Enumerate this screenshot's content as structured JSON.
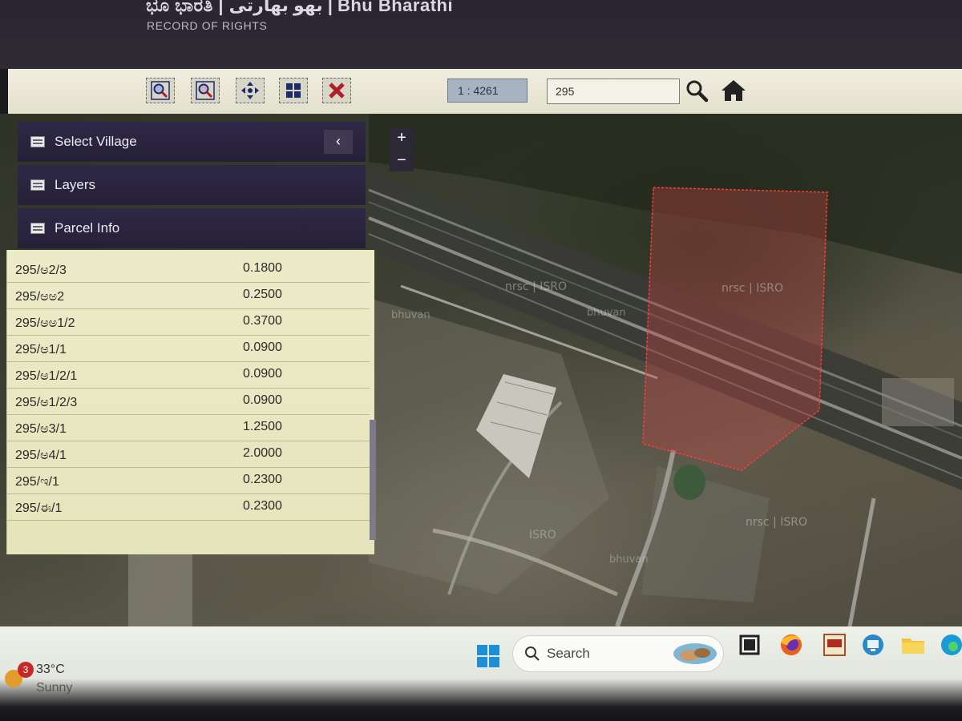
{
  "header": {
    "title": "ಭೂ ಭಾರತಿ | بهو بھارتی | Bhu Bharathi",
    "subtitle": "RECORD OF RIGHTS"
  },
  "toolbar": {
    "tools": [
      {
        "icon": "zoom-in-tool-icon"
      },
      {
        "icon": "zoom-out-tool-icon"
      },
      {
        "icon": "pan-tool-icon"
      },
      {
        "icon": "full-extent-tool-icon"
      },
      {
        "icon": "clear-tool-icon"
      }
    ],
    "scale": "1 : 4261",
    "search_value": "295",
    "search_icon": "magnifier-icon",
    "home_icon": "home-icon"
  },
  "map": {
    "zoom_in": "+",
    "zoom_out": "−",
    "watermarks": [
      "nrsc | ISRO",
      "bhuvan",
      "nrsc | ISRO",
      "bhuvan",
      "ISRO",
      "nrsc | ISRO",
      "bhuvan"
    ],
    "parcel_outline_color": "#ff3b3b"
  },
  "panel": {
    "select_village": "Select Village",
    "layers": "Layers",
    "parcel_info": "Parcel Info",
    "collapse_icon": "chevron-left-icon",
    "parcels": [
      {
        "id": "295/ಅ2/3",
        "area": "0.1800"
      },
      {
        "id": "295/ಅಅ2",
        "area": "0.2500"
      },
      {
        "id": "295/ಅಅ1/2",
        "area": "0.3700"
      },
      {
        "id": "295/ಅ1/1",
        "area": "0.0900"
      },
      {
        "id": "295/ಅ1/2/1",
        "area": "0.0900"
      },
      {
        "id": "295/ಅ1/2/3",
        "area": "0.0900"
      },
      {
        "id": "295/ಅ3/1",
        "area": "1.2500"
      },
      {
        "id": "295/ಅ4/1",
        "area": "2.0000"
      },
      {
        "id": "295/ಇ/1",
        "area": "0.2300"
      },
      {
        "id": "295/ಈ/1",
        "area": "0.2300"
      }
    ]
  },
  "taskbar": {
    "weather_badge": "3",
    "temperature": "33°C",
    "condition": "Sunny",
    "search_label": "Search"
  }
}
